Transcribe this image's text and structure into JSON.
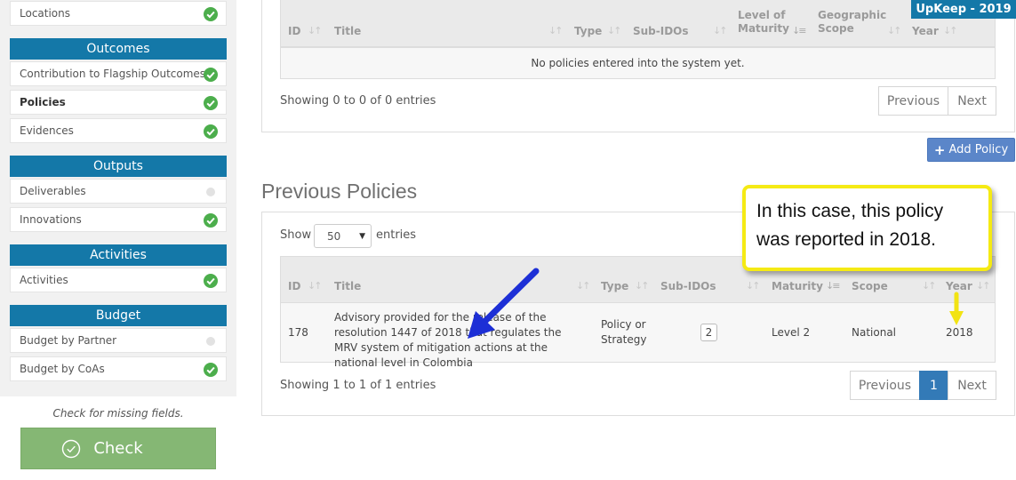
{
  "sidebar": {
    "items": [
      {
        "label": "Locations",
        "status": "complete"
      },
      {
        "label": "Contribution to Flagship Outcomes",
        "status": "complete"
      },
      {
        "label": "Policies",
        "status": "complete",
        "active": true
      },
      {
        "label": "Evidences",
        "status": "complete"
      },
      {
        "label": "Deliverables",
        "status": "pending"
      },
      {
        "label": "Innovations",
        "status": "complete"
      },
      {
        "label": "Activities",
        "status": "complete"
      },
      {
        "label": "Budget by Partner",
        "status": "pending"
      },
      {
        "label": "Budget by CoAs",
        "status": "complete"
      }
    ],
    "sections": {
      "outcomes": "Outcomes",
      "outputs": "Outputs",
      "activities": "Activities",
      "budget": "Budget"
    },
    "missing_note": "Check for missing fields.",
    "check_button": "Check"
  },
  "badge": "UpKeep - 2019",
  "current_table": {
    "headers": {
      "id": "ID",
      "title": "Title",
      "type": "Type",
      "sub_idos": "Sub-IDOs",
      "maturity": "Level of Maturity",
      "scope": "Geographic Scope",
      "year": "Year"
    },
    "empty_message": "No policies entered into the system yet.",
    "showing": "Showing 0 to 0 of 0 entries",
    "previous": "Previous",
    "next": "Next"
  },
  "add_policy": "Add Policy",
  "previous_policies": {
    "title": "Previous Policies",
    "show_label": "Show",
    "entries_label": "entries",
    "page_size": "50",
    "headers": {
      "id": "ID",
      "title": "Title",
      "type": "Type",
      "sub_idos": "Sub-IDOs",
      "maturity": "Maturity",
      "scope": "Scope",
      "year": "Year"
    },
    "rows": [
      {
        "id": "178",
        "title": "Advisory provided for the release of the resolution 1447 of 2018 that regulates the MRV system of mitigation actions at the national level in Colombia",
        "type": "Policy or Strategy",
        "sub_idos": "2",
        "maturity": "Level 2",
        "scope": "National",
        "year": "2018"
      }
    ],
    "showing": "Showing 1 to 1 of 1 entries",
    "previous": "Previous",
    "page": "1",
    "next": "Next"
  },
  "annotation": {
    "text": "In this case, this policy was reported in 2018.",
    "border_color": "#f5ea14",
    "arrow_blue": "#1d2fd6",
    "arrow_yellow": "#f2e313"
  },
  "colors": {
    "brand": "#1478a8",
    "success": "#4cae4c",
    "check_button": "#85b774",
    "add_button": "#5b86c9",
    "page_active": "#337ab7"
  }
}
